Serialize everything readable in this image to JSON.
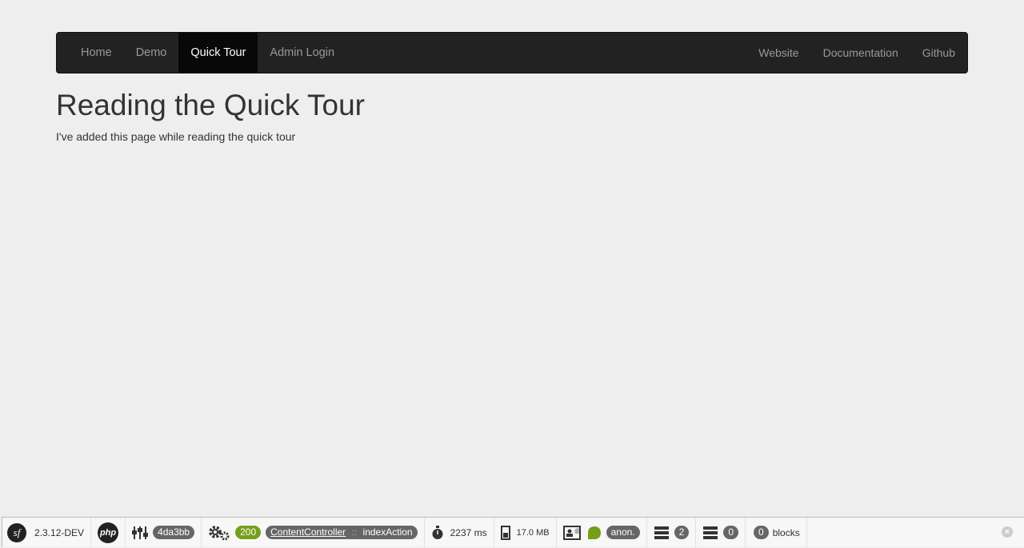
{
  "nav": {
    "left": [
      {
        "label": "Home",
        "active": false
      },
      {
        "label": "Demo",
        "active": false
      },
      {
        "label": "Quick Tour",
        "active": true
      },
      {
        "label": "Admin Login",
        "active": false
      }
    ],
    "right": [
      {
        "label": "Website"
      },
      {
        "label": "Documentation"
      },
      {
        "label": "Github"
      }
    ]
  },
  "page": {
    "title": "Reading the Quick Tour",
    "text": "I've added this page while reading the quick tour"
  },
  "toolbar": {
    "sf_logo": "sf",
    "version": "2.3.12-DEV",
    "php_logo": "php",
    "token": "4da3bb",
    "status_code": "200",
    "controller": "ContentController",
    "controller_sep": "::",
    "action": "indexAction",
    "time": "2237 ms",
    "memory": "17.0 MB",
    "user": "anon.",
    "db_queries": "2",
    "queries_2": "0",
    "blocks_count": "0",
    "blocks_label": "blocks",
    "close_glyph": "×"
  },
  "colors": {
    "navbar_bg": "#222222",
    "navbar_active": "#080808",
    "status_green": "#759e1a",
    "badge_gray": "#666666"
  }
}
